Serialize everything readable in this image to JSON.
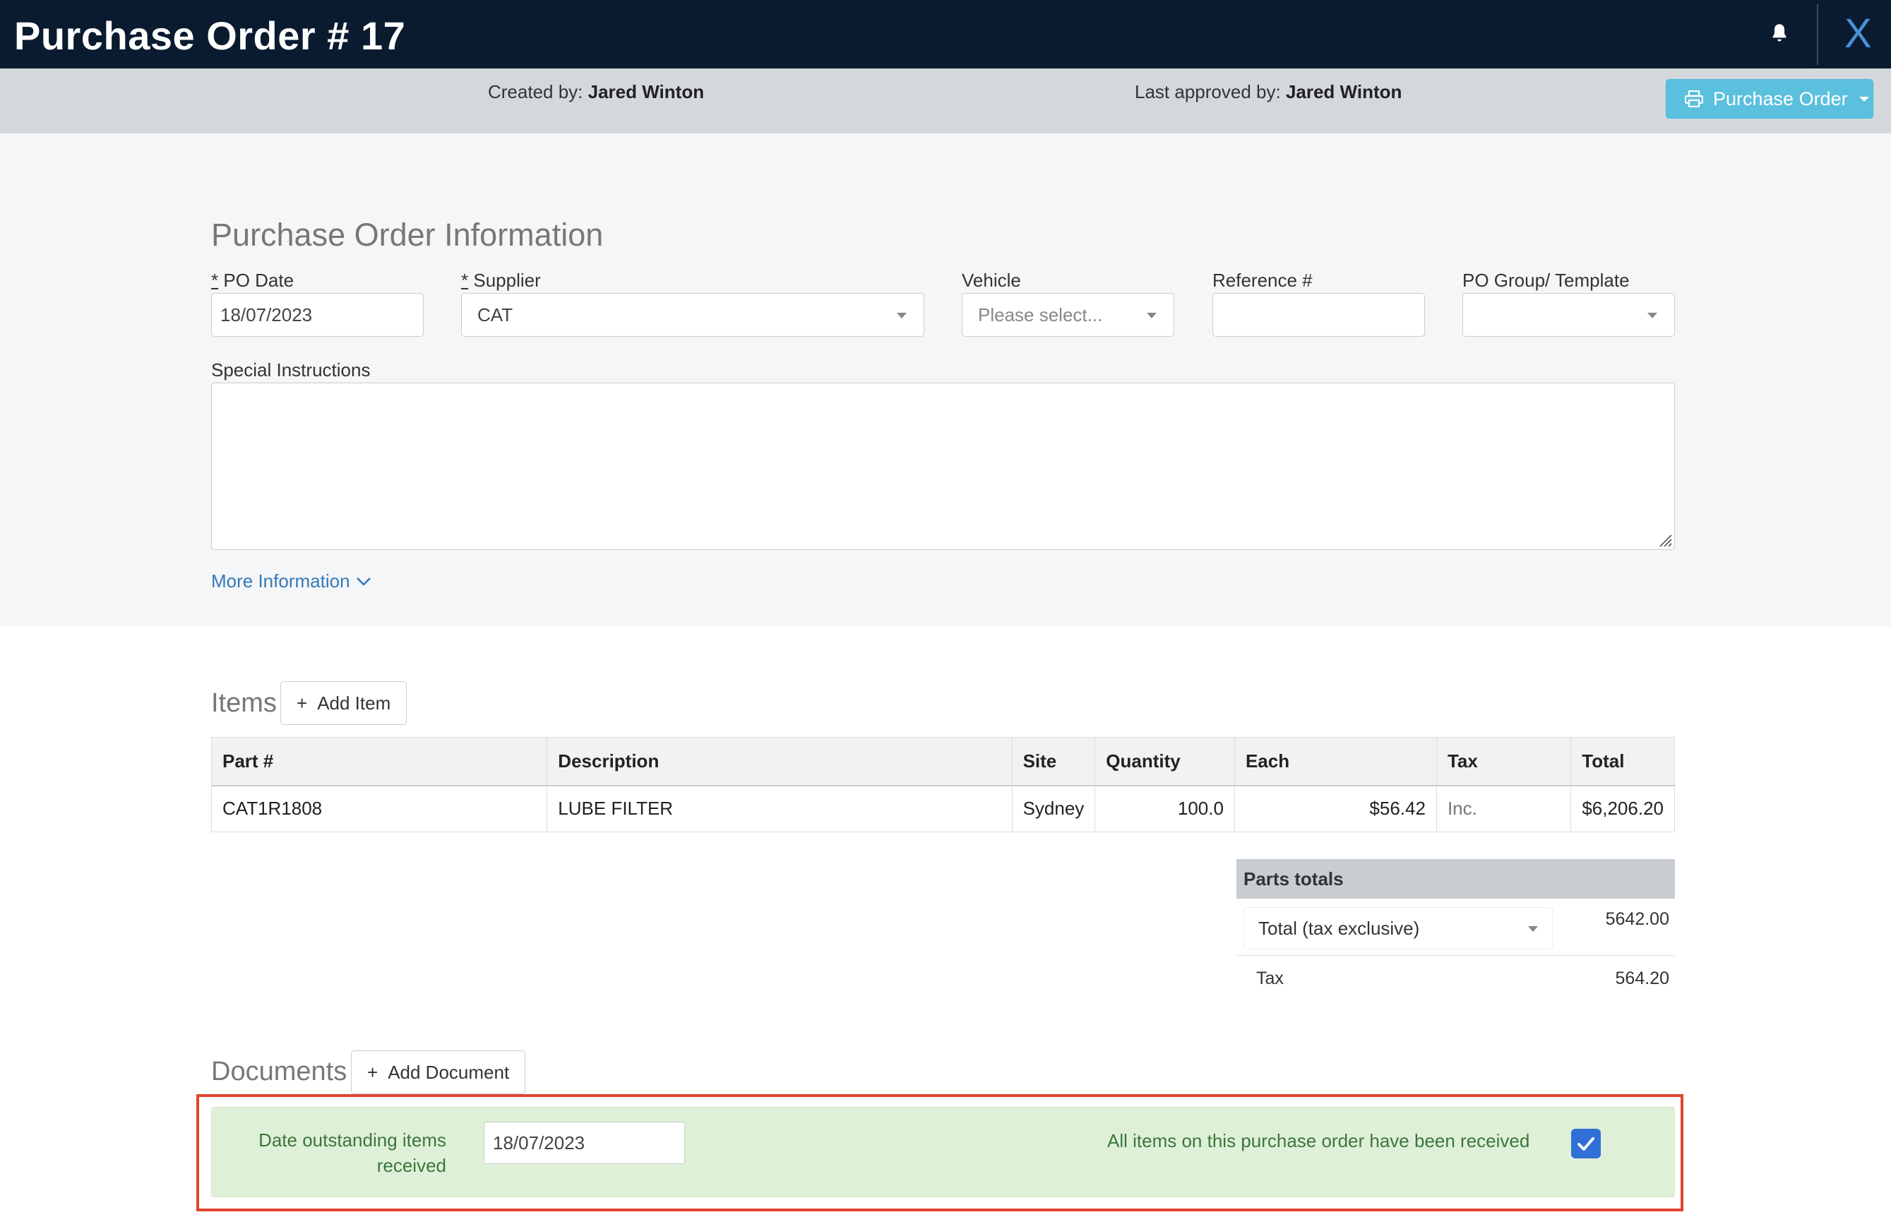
{
  "header": {
    "title": "Purchase Order # 17",
    "close_label": "X",
    "bell_icon": "bell-icon"
  },
  "info_bar": {
    "created_by_label": "Created by:",
    "created_by_name": "Jared Winton",
    "approved_by_label": "Last approved by:",
    "approved_by_name": "Jared Winton",
    "print_button_label": "Purchase Order",
    "print_icon": "printer-icon"
  },
  "po_info": {
    "heading": "Purchase Order Information",
    "po_date": {
      "required": "*",
      "label": "PO Date",
      "value": "18/07/2023"
    },
    "supplier": {
      "required": "*",
      "label": "Supplier",
      "value": "CAT"
    },
    "vehicle": {
      "label": "Vehicle",
      "placeholder": "Please select..."
    },
    "reference": {
      "label": "Reference #",
      "value": ""
    },
    "po_group": {
      "label": "PO Group/ Template",
      "value": ""
    },
    "special_instructions_label": "Special Instructions",
    "special_instructions_value": "",
    "more_information_label": "More Information"
  },
  "items": {
    "heading": "Items",
    "add_label": "Add Item",
    "columns": [
      "Part #",
      "Description",
      "Site",
      "Quantity",
      "Each",
      "Tax",
      "Total"
    ],
    "rows": [
      {
        "part": "CAT1R1808",
        "description": "LUBE FILTER",
        "site": "Sydney",
        "quantity": "100.0",
        "each": "$56.42",
        "tax": "Inc.",
        "total": "$6,206.20"
      }
    ]
  },
  "parts_totals": {
    "heading": "Parts totals",
    "total_select_value": "Total (tax exclusive)",
    "total_value": "5642.00",
    "tax_label": "Tax",
    "tax_value": "564.20"
  },
  "documents": {
    "heading": "Documents",
    "add_label": "Add Document"
  },
  "received": {
    "date_label": "Date outstanding items received",
    "date_value": "18/07/2023",
    "message": "All items on this purchase order have been received",
    "checked": true
  },
  "colors": {
    "topbar": "#0b1b2f",
    "info_button": "#5bc0de",
    "success_bg": "#dff0d8",
    "success_text": "#3c763d",
    "highlight_border": "#e0452e",
    "checkbox": "#2f6fd6"
  }
}
